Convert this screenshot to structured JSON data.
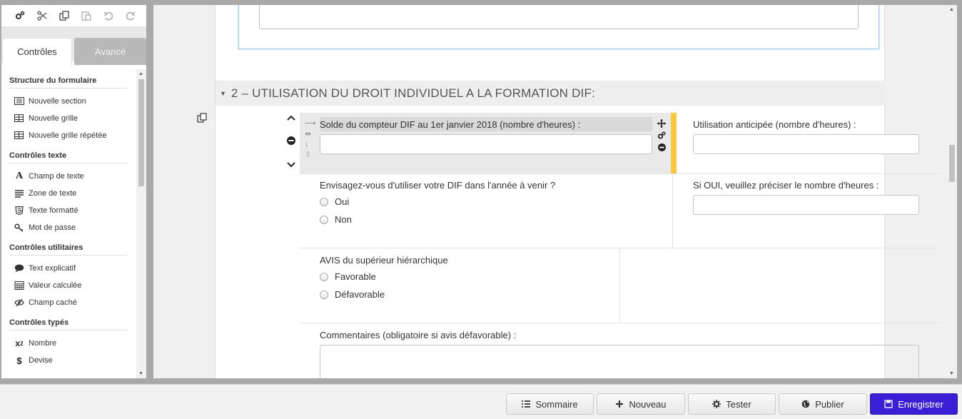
{
  "left_panel": {
    "tabs": {
      "controls": "Contrôles",
      "advanced": "Avancé"
    },
    "sections": [
      {
        "title": "Structure du formulaire",
        "items": [
          {
            "label": "Nouvelle section",
            "icon": "section-icon"
          },
          {
            "label": "Nouvelle grille",
            "icon": "grid-icon"
          },
          {
            "label": "Nouvelle grille répétée",
            "icon": "repeat-grid-icon"
          }
        ]
      },
      {
        "title": "Contrôles texte",
        "items": [
          {
            "label": "Champ de texte",
            "icon": "text-field-icon"
          },
          {
            "label": "Zone de texte",
            "icon": "text-area-icon"
          },
          {
            "label": "Texte formatté",
            "icon": "html5-icon"
          },
          {
            "label": "Mot de passe",
            "icon": "key-icon"
          }
        ]
      },
      {
        "title": "Contrôles utilitaires",
        "items": [
          {
            "label": "Text explicatif",
            "icon": "comment-icon"
          },
          {
            "label": "Valeur calculée",
            "icon": "calculator-icon"
          },
          {
            "label": "Champ caché",
            "icon": "eye-slash-icon"
          }
        ]
      },
      {
        "title": "Contrôles typés",
        "items": [
          {
            "label": "Nombre",
            "icon": "superscript-icon"
          },
          {
            "label": "Devise",
            "icon": "dollar-icon"
          }
        ]
      }
    ]
  },
  "form": {
    "section_title": "2 – UTILISATION DU DROIT INDIVIDUEL A LA FORMATION DIF:",
    "row1": {
      "left_label": "Solde du compteur DIF au 1er janvier 2018 (nombre d'heures) :",
      "left_value": "",
      "right_label": "Utilisation anticipée (nombre d'heures) :",
      "right_value": ""
    },
    "row2": {
      "question": "Envisagez-vous d'utiliser votre DIF dans l'année à venir ?",
      "options": [
        "Oui",
        "Non"
      ],
      "right_label": "Si OUI, veuillez préciser le nombre d'heures :",
      "right_value": ""
    },
    "row3": {
      "question": "AVIS du supérieur hiérarchique",
      "options": [
        "Favorable",
        "Défavorable"
      ]
    },
    "row4": {
      "label": "Commentaires (obligatoire si avis défavorable) :",
      "value": ""
    }
  },
  "bottom_bar": {
    "summary": "Sommaire",
    "new": "Nouveau",
    "test": "Tester",
    "publish": "Publier",
    "save": "Enregistrer"
  },
  "colors": {
    "primary": "#3a1fd6",
    "selection": "#f8c93c"
  }
}
